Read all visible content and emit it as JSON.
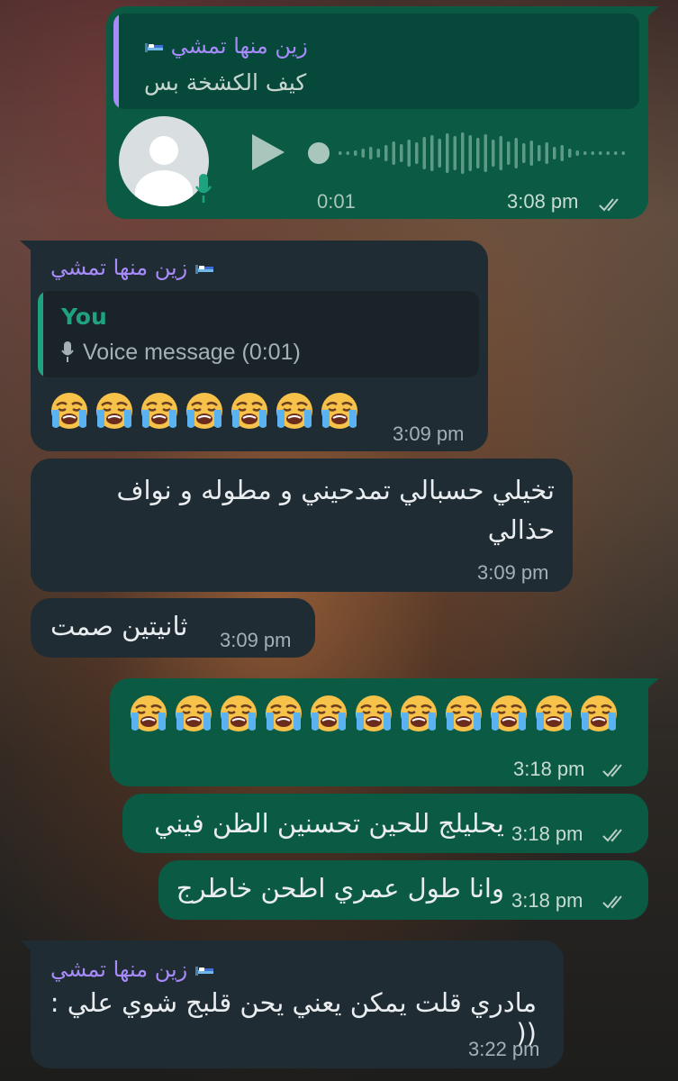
{
  "colors": {
    "outgoing_bubble": "#0b5a44",
    "incoming_bubble": "#202c33",
    "sender_name": "#a78bfa",
    "quote_you": "#1fa37f"
  },
  "messages": [
    {
      "id": "m1",
      "direction": "outgoing",
      "quote": {
        "sender": "زين منها تمشي",
        "sender_emoji_icon": "bed-icon",
        "text": "كيف الكشخة بس"
      },
      "voice": {
        "duration": "0:01",
        "play_icon": "play-icon",
        "mic_icon": "mic-icon"
      },
      "time": "3:08 pm",
      "status_icon": "double-check-icon"
    },
    {
      "id": "m2",
      "direction": "incoming",
      "sender": "زين منها تمشي",
      "quote": {
        "sender": "You",
        "text": "Voice message (0:01)"
      },
      "emoji_icon": "loudly-crying-face",
      "emoji_count": 7,
      "time": "3:09 pm"
    },
    {
      "id": "m3",
      "direction": "incoming",
      "text_line1": "تخيلي حسبالي تمدحيني و مطوله و نواف",
      "text_line2": "حذالي",
      "time": "3:09 pm"
    },
    {
      "id": "m4",
      "direction": "incoming",
      "text": "ثانيتين صمت",
      "time": "3:09 pm"
    },
    {
      "id": "m5",
      "direction": "outgoing",
      "emoji_icon": "loudly-crying-face",
      "emoji_count": 11,
      "time": "3:18 pm"
    },
    {
      "id": "m6",
      "direction": "outgoing",
      "text": "يحليلج للحين تحسنين الظن فيني",
      "time": "3:18 pm"
    },
    {
      "id": "m7",
      "direction": "outgoing",
      "text": "وانا طول عمري اطحن خاطرج",
      "time": "3:18 pm"
    },
    {
      "id": "m8",
      "direction": "incoming",
      "sender": "زين منها تمشي",
      "text": "مادري قلت يمكن يعني يحن قلبج شوي علي :((",
      "time": "3:22 pm"
    }
  ]
}
